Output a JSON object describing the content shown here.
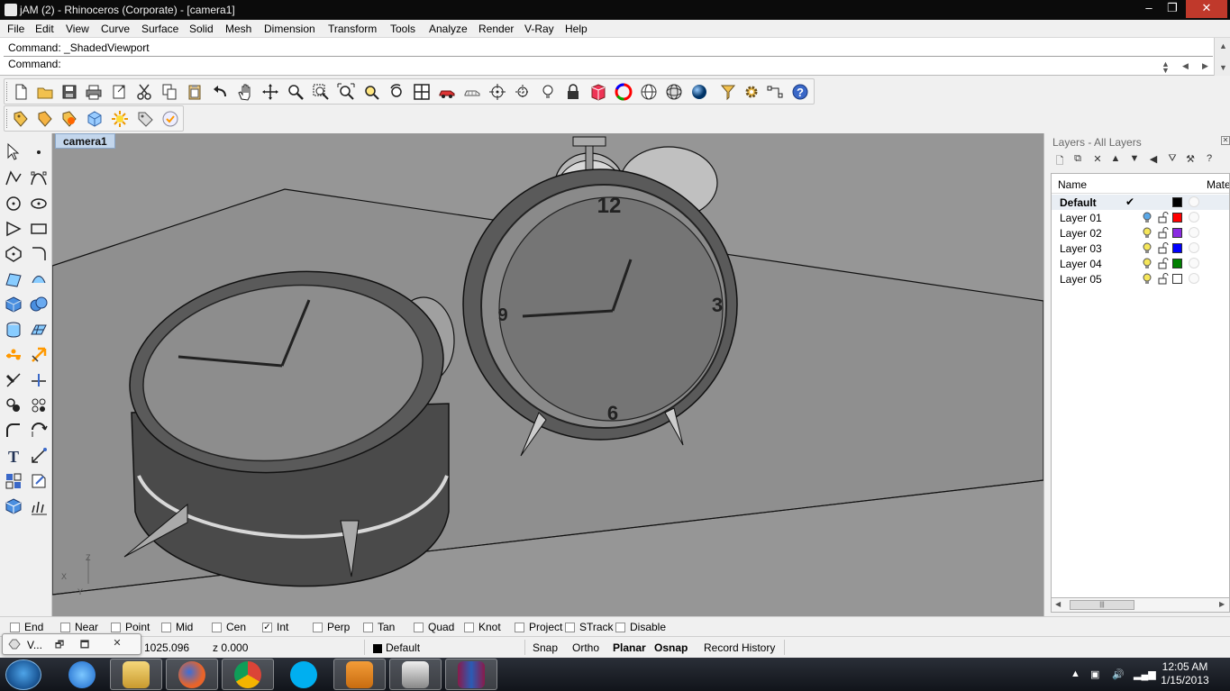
{
  "window": {
    "title": "jAM (2) - Rhinoceros (Corporate) - [camera1]",
    "min": "–",
    "max": "❐",
    "close": "✕"
  },
  "menu": [
    "File",
    "Edit",
    "View",
    "Curve",
    "Surface",
    "Solid",
    "Mesh",
    "Dimension",
    "Transform",
    "Tools",
    "Analyze",
    "Render",
    "V-Ray",
    "Help"
  ],
  "command": {
    "history": "Command: _ShadedViewport",
    "prompt": "Command:",
    "value": ""
  },
  "viewport": {
    "tab": "camera1",
    "clock_front_numbers": [
      "12",
      "3",
      "6",
      "9"
    ],
    "axis_z": "Z",
    "axis_x": "X",
    "axis_y": "Y"
  },
  "layers_panel": {
    "title": "Layers - All Layers",
    "col_name": "Name",
    "col_material": "Mater",
    "layers": [
      {
        "name": "Default",
        "current": "✔",
        "color": "#000000"
      },
      {
        "name": "Layer 01",
        "current": "",
        "color": "#ff0000"
      },
      {
        "name": "Layer 02",
        "current": "",
        "color": "#8a2be2"
      },
      {
        "name": "Layer 03",
        "current": "",
        "color": "#0000ff"
      },
      {
        "name": "Layer 04",
        "current": "",
        "color": "#008000"
      },
      {
        "name": "Layer 05",
        "current": "",
        "color": "#ffffff"
      }
    ],
    "scroll_thumb": "|||"
  },
  "osnap": [
    {
      "label": "End",
      "checked": false
    },
    {
      "label": "Near",
      "checked": false
    },
    {
      "label": "Point",
      "checked": false
    },
    {
      "label": "Mid",
      "checked": false
    },
    {
      "label": "Cen",
      "checked": false
    },
    {
      "label": "Int",
      "checked": true
    },
    {
      "label": "Perp",
      "checked": false
    },
    {
      "label": "Tan",
      "checked": false
    },
    {
      "label": "Quad",
      "checked": false
    },
    {
      "label": "Knot",
      "checked": false
    },
    {
      "label": "Project",
      "checked": false
    },
    {
      "label": "STrack",
      "checked": false
    },
    {
      "label": "Disable",
      "checked": false
    }
  ],
  "status": {
    "y_coord": "1025.096",
    "z_coord": "z 0.000",
    "layer": "Default",
    "snap": "Snap",
    "ortho": "Ortho",
    "planar": "Planar",
    "osnap": "Osnap",
    "record_history": "Record History"
  },
  "mini_window": {
    "label": "V...",
    "restore": "🗗",
    "maximize": "🗖",
    "close": "✕"
  },
  "taskbar": {
    "time": "12:05 AM",
    "date": "1/15/2013",
    "apps": [
      "Internet Explorer",
      "Windows Explorer",
      "Firefox",
      "Chrome",
      "Skype",
      "Media Player",
      "Rhinoceros",
      "WinRAR"
    ]
  },
  "colors": {
    "viewport_bg": "#969696",
    "title_bg": "#0b0b0b",
    "close_red": "#c0392b",
    "tab_blue": "#c3d6ec"
  }
}
